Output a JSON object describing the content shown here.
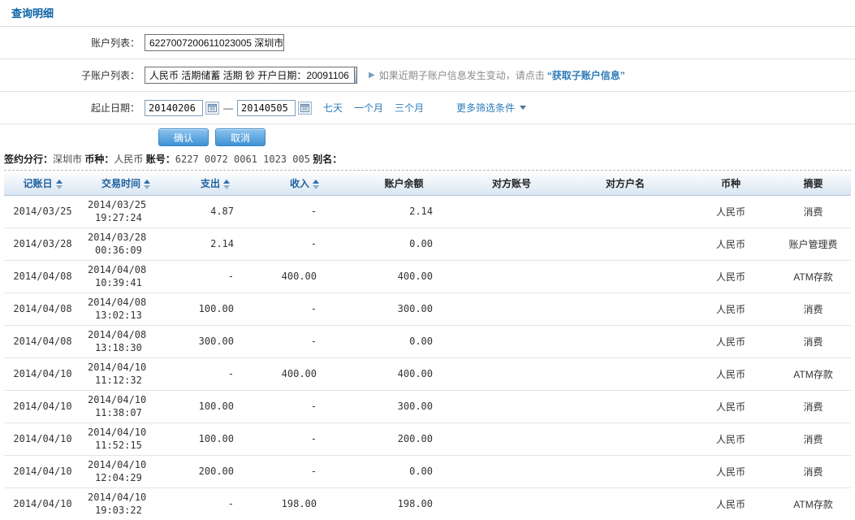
{
  "page": {
    "title": "查询明细"
  },
  "filters": {
    "account_list": {
      "label": "账户列表：",
      "value": "6227007200611023005 深圳市"
    },
    "sub_account_list": {
      "label": "子账户列表：",
      "value": "人民币 活期储蓄 活期 钞 开户日期：20091106",
      "hint_prefix": "如果近期子账户信息发生变动，请点击",
      "hint_link": "“获取子账户信息”"
    },
    "date_range": {
      "label": "起止日期：",
      "start": "20140206",
      "end": "20140505",
      "separator": "—",
      "quick_links": [
        "七天",
        "一个月",
        "三个月"
      ],
      "more_filters": "更多筛选条件"
    },
    "confirm_label": "确认",
    "cancel_label": "取消"
  },
  "account_summary": {
    "branch_label": "签约分行：",
    "branch_value": "深圳市",
    "currency_label": "币种：",
    "currency_value": "人民币",
    "account_label": "账号：",
    "account_value": "6227 0072 0061 1023 005",
    "alias_label": "别名："
  },
  "table": {
    "columns": [
      {
        "label": "记账日",
        "sortable": true
      },
      {
        "label": "交易时间",
        "sortable": true
      },
      {
        "label": "支出",
        "sortable": true
      },
      {
        "label": "收入",
        "sortable": true
      },
      {
        "label": "账户余额",
        "sortable": false
      },
      {
        "label": "对方账号",
        "sortable": false
      },
      {
        "label": "对方户名",
        "sortable": false
      },
      {
        "label": "币种",
        "sortable": false
      },
      {
        "label": "摘要",
        "sortable": false
      }
    ],
    "rows": [
      {
        "date": "2014/03/25",
        "time_date": "2014/03/25",
        "time": "19:27:24",
        "out": "4.87",
        "in": "-",
        "balance": "2.14",
        "counter_account": "",
        "counter_name": "",
        "currency": "人民币",
        "summary": "消费"
      },
      {
        "date": "2014/03/28",
        "time_date": "2014/03/28",
        "time": "00:36:09",
        "out": "2.14",
        "in": "-",
        "balance": "0.00",
        "counter_account": "",
        "counter_name": "",
        "currency": "人民币",
        "summary": "账户管理费"
      },
      {
        "date": "2014/04/08",
        "time_date": "2014/04/08",
        "time": "10:39:41",
        "out": "-",
        "in": "400.00",
        "balance": "400.00",
        "counter_account": "",
        "counter_name": "",
        "currency": "人民币",
        "summary": "ATM存款"
      },
      {
        "date": "2014/04/08",
        "time_date": "2014/04/08",
        "time": "13:02:13",
        "out": "100.00",
        "in": "-",
        "balance": "300.00",
        "counter_account": "",
        "counter_name": "",
        "currency": "人民币",
        "summary": "消费"
      },
      {
        "date": "2014/04/08",
        "time_date": "2014/04/08",
        "time": "13:18:30",
        "out": "300.00",
        "in": "-",
        "balance": "0.00",
        "counter_account": "",
        "counter_name": "",
        "currency": "人民币",
        "summary": "消费"
      },
      {
        "date": "2014/04/10",
        "time_date": "2014/04/10",
        "time": "11:12:32",
        "out": "-",
        "in": "400.00",
        "balance": "400.00",
        "counter_account": "",
        "counter_name": "",
        "currency": "人民币",
        "summary": "ATM存款"
      },
      {
        "date": "2014/04/10",
        "time_date": "2014/04/10",
        "time": "11:38:07",
        "out": "100.00",
        "in": "-",
        "balance": "300.00",
        "counter_account": "",
        "counter_name": "",
        "currency": "人民币",
        "summary": "消费"
      },
      {
        "date": "2014/04/10",
        "time_date": "2014/04/10",
        "time": "11:52:15",
        "out": "100.00",
        "in": "-",
        "balance": "200.00",
        "counter_account": "",
        "counter_name": "",
        "currency": "人民币",
        "summary": "消费"
      },
      {
        "date": "2014/04/10",
        "time_date": "2014/04/10",
        "time": "12:04:29",
        "out": "200.00",
        "in": "-",
        "balance": "0.00",
        "counter_account": "",
        "counter_name": "",
        "currency": "人民币",
        "summary": "消费"
      },
      {
        "date": "2014/04/10",
        "time_date": "2014/04/10",
        "time": "19:03:22",
        "out": "-",
        "in": "198.00",
        "balance": "198.00",
        "counter_account": "",
        "counter_name": "",
        "currency": "人民币",
        "summary": "ATM存款"
      }
    ]
  },
  "colors": {
    "accent_blue": "#0b62a4",
    "link_blue": "#2b7bb9",
    "header_text_blue": "#1c5f9e",
    "header_bg_top": "#fcfdfe",
    "header_bg_bottom": "#d9e6f2",
    "button_top": "#8cc3ee",
    "button_bottom": "#3e92d5"
  }
}
